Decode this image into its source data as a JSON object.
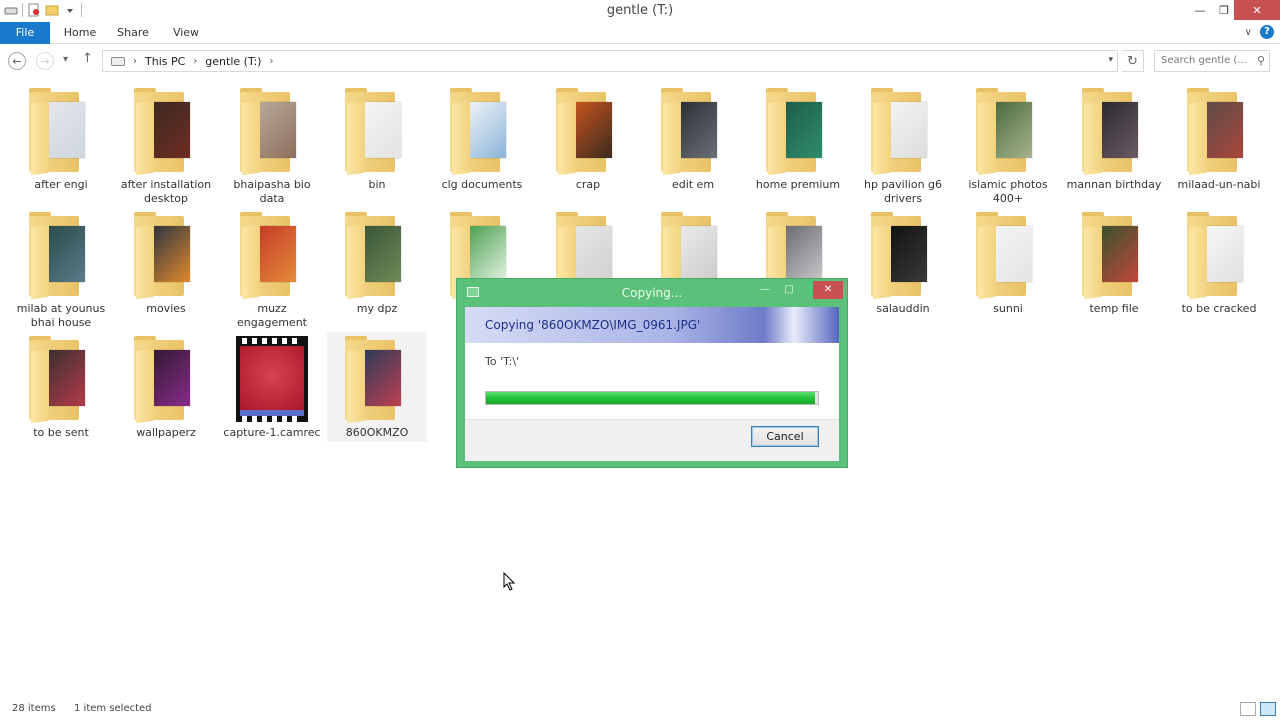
{
  "window": {
    "title": "gentle (T:)"
  },
  "ribbon": {
    "tabs": [
      "File",
      "Home",
      "Share",
      "View"
    ]
  },
  "address": {
    "crumbs": [
      "This PC",
      "gentle (T:)"
    ],
    "search_placeholder": "Search gentle (..."
  },
  "items": [
    {
      "label": "after engi",
      "kind": "folder",
      "colors": [
        "#e4e6ea",
        "#cfd6df"
      ]
    },
    {
      "label": "after installation desktop",
      "kind": "folder",
      "colors": [
        "#3b2a22",
        "#6f2c22"
      ]
    },
    {
      "label": "bhaipasha bio data",
      "kind": "folder",
      "colors": [
        "#b9a89a",
        "#8c6f5c"
      ]
    },
    {
      "label": "bin",
      "kind": "folder",
      "colors": [
        "#f5f5f5",
        "#e2e2e2"
      ]
    },
    {
      "label": "clg documents",
      "kind": "folder",
      "colors": [
        "#eef3f7",
        "#8ab4d8"
      ]
    },
    {
      "label": "crap",
      "kind": "folder",
      "colors": [
        "#c7561d",
        "#3a2a1e"
      ]
    },
    {
      "label": "edit em",
      "kind": "folder",
      "colors": [
        "#2c2f34",
        "#6b6f77"
      ]
    },
    {
      "label": "home premium",
      "kind": "folder",
      "colors": [
        "#1e5d4a",
        "#2f8b6e"
      ]
    },
    {
      "label": "hp pavilion g6 drivers",
      "kind": "folder",
      "colors": [
        "#f4f4f4",
        "#dcdcdc"
      ]
    },
    {
      "label": "islamic photos 400+",
      "kind": "folder",
      "colors": [
        "#4a6b3a",
        "#a7b38d"
      ]
    },
    {
      "label": "mannan birthday",
      "kind": "folder",
      "colors": [
        "#2a2a30",
        "#6a5a62"
      ]
    },
    {
      "label": "milaad-un-nabi",
      "kind": "folder",
      "colors": [
        "#5d4d48",
        "#a8463c"
      ]
    },
    {
      "label": "milab at younus bhai house",
      "kind": "folder",
      "colors": [
        "#2a4a4a",
        "#5a7c8a"
      ]
    },
    {
      "label": "movies",
      "kind": "folder",
      "colors": [
        "#2b3440",
        "#e08a2c"
      ]
    },
    {
      "label": "muzz engagement",
      "kind": "folder",
      "colors": [
        "#c53a28",
        "#e58b3a"
      ]
    },
    {
      "label": "my dpz",
      "kind": "folder",
      "colors": [
        "#38553a",
        "#6f8b55"
      ]
    },
    {
      "label": "",
      "kind": "folder-hidden",
      "colors": [
        "#4aa04f",
        "#e5f1e2"
      ]
    },
    {
      "label": "",
      "kind": "folder-hidden",
      "colors": [
        "#e6e6e6",
        "#d0d0d0"
      ]
    },
    {
      "label": "",
      "kind": "folder-hidden",
      "colors": [
        "#eaeaea",
        "#cccccc"
      ]
    },
    {
      "label": "",
      "kind": "folder-hidden",
      "colors": [
        "#6a6a70",
        "#c9c9cc"
      ]
    },
    {
      "label": "salauddin",
      "kind": "folder",
      "colors": [
        "#111111",
        "#3a3a3a"
      ]
    },
    {
      "label": "sunni",
      "kind": "folder",
      "colors": [
        "#f4f4f4",
        "#e4e4e4"
      ]
    },
    {
      "label": "temp file",
      "kind": "folder",
      "colors": [
        "#37522c",
        "#c2473a"
      ]
    },
    {
      "label": "to be cracked",
      "kind": "folder",
      "colors": [
        "#f7f7f7",
        "#e0e0e0"
      ]
    },
    {
      "label": "to be sent",
      "kind": "folder",
      "colors": [
        "#3a3030",
        "#b43a4a"
      ]
    },
    {
      "label": "wallpaperz",
      "kind": "folder",
      "colors": [
        "#301a30",
        "#8a2a8a"
      ]
    },
    {
      "label": "capture-1.camrec",
      "kind": "video",
      "colors": [
        "#c2283a",
        "#5b6cc9"
      ]
    },
    {
      "label": "860OKMZO",
      "kind": "folder",
      "colors": [
        "#2a3a5a",
        "#c04050"
      ],
      "selected": true
    }
  ],
  "dialog": {
    "title": "Copying...",
    "heading": "Copying '860OKMZO\\IMG_0961.JPG'",
    "to_text": "To 'T:\\'",
    "cancel_label": "Cancel",
    "progress": 0.99,
    "accent": "#5bc07a"
  },
  "status": {
    "count": "28 items",
    "selection": "1 item selected"
  }
}
